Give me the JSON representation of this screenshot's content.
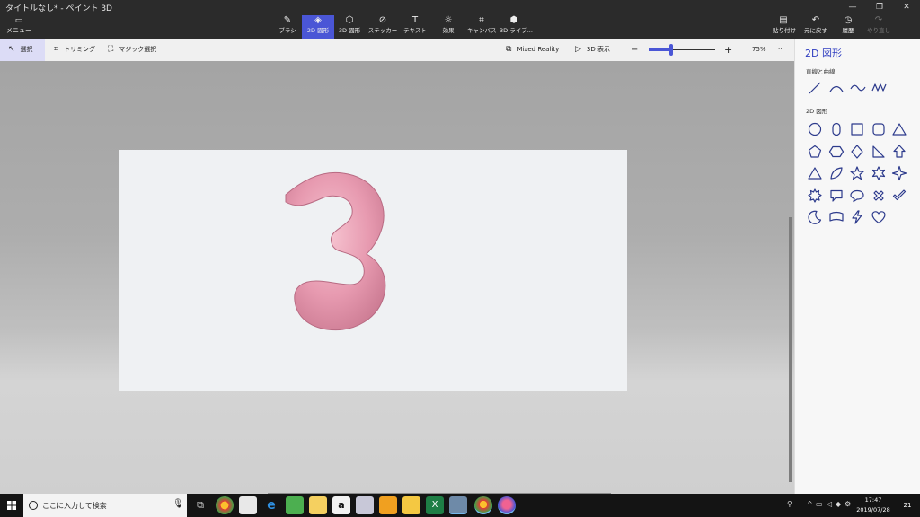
{
  "window": {
    "title": "タイトルなし* - ペイント 3D",
    "menu_label": "メニュー"
  },
  "tools": [
    {
      "id": "brush",
      "label": "ブラシ",
      "icon": "brush-icon"
    },
    {
      "id": "2d-shapes",
      "label": "2D 図形",
      "icon": "2d-shapes-icon",
      "active": true
    },
    {
      "id": "3d-shapes",
      "label": "3D 図形",
      "icon": "3d-shapes-icon"
    },
    {
      "id": "stickers",
      "label": "ステッカー",
      "icon": "sticker-icon"
    },
    {
      "id": "text",
      "label": "テキスト",
      "icon": "text-icon"
    },
    {
      "id": "effects",
      "label": "効果",
      "icon": "effects-icon"
    },
    {
      "id": "canvas",
      "label": "キャンバス",
      "icon": "canvas-icon"
    },
    {
      "id": "3d-library",
      "label": "3D ライブ...",
      "icon": "3d-library-icon"
    }
  ],
  "actions": [
    {
      "id": "paste",
      "label": "貼り付け",
      "icon": "paste-icon"
    },
    {
      "id": "undo",
      "label": "元に戻す",
      "icon": "undo-icon"
    },
    {
      "id": "history",
      "label": "履歴",
      "icon": "history-icon"
    },
    {
      "id": "redo",
      "label": "やり直し",
      "icon": "redo-icon",
      "disabled": true
    }
  ],
  "subtoolbar": {
    "select": "選択",
    "crop": "トリミング",
    "magic_select": "マジック選択",
    "mixed_reality": "Mixed Reality",
    "view_3d": "3D 表示",
    "zoom_minus": "−",
    "zoom_plus": "+",
    "zoom_value": "75%",
    "more": "···"
  },
  "panel": {
    "title": "2D 図形",
    "lines_title": "直線と曲線",
    "shapes_title": "2D 図形",
    "line_tools": [
      "line-icon",
      "curve-icon",
      "wave-curve-icon",
      "multi-curve-icon"
    ],
    "shapes": [
      "circle-icon",
      "pill-icon",
      "square-icon",
      "rounded-square-icon",
      "triangle-icon",
      "pentagon-icon",
      "hexagon-icon",
      "diamond-icon",
      "right-triangle-icon",
      "arrow-up-icon",
      "triangle-outline-icon",
      "leaf-icon",
      "star-5-icon",
      "star-6-icon",
      "star-4-icon",
      "burst-icon",
      "speech-bubble-icon",
      "round-bubble-icon",
      "cross-icon",
      "checkmark-icon",
      "moon-icon",
      "banner-icon",
      "lightning-icon",
      "heart-icon"
    ]
  },
  "canvas": {
    "drawing": "3"
  },
  "taskbar": {
    "search_placeholder": "ここに入力して検索",
    "time": "17:47",
    "date": "2019/07/28",
    "notification_count": "21"
  },
  "colors": {
    "accent": "#4a56d6",
    "shape_stroke": "#2c3a8c",
    "digit_pink": "#e59aaf"
  }
}
